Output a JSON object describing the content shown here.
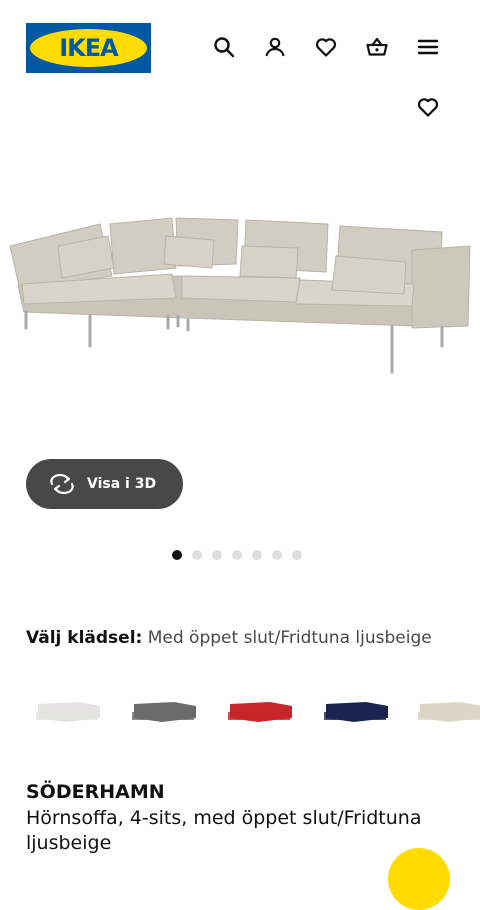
{
  "header": {
    "logo_text": "IKEA",
    "icons": [
      "search-icon",
      "user-icon",
      "heart-icon",
      "shopping-basket-icon",
      "menu-icon"
    ]
  },
  "gallery": {
    "view_3d_label": "Visa i 3D",
    "image_count": 7,
    "active_image": 1
  },
  "variant": {
    "label": "Välj klädsel:",
    "value": "Med öppet slut/Fridtuna ljusbeige",
    "swatch_colors": [
      "#e4e3df",
      "#6b6b6b",
      "#c8262b",
      "#1b2350",
      "#ddd6c6"
    ]
  },
  "product": {
    "name": "SÖDERHAMN",
    "description": "Hörnsoffa, 4-sits, med öppet slut/Fridtuna ljusbeige"
  },
  "colors": {
    "ikea_blue": "#0058a3",
    "ikea_yellow": "#ffdb00",
    "sofa_fabric": "#cfcbc0"
  }
}
